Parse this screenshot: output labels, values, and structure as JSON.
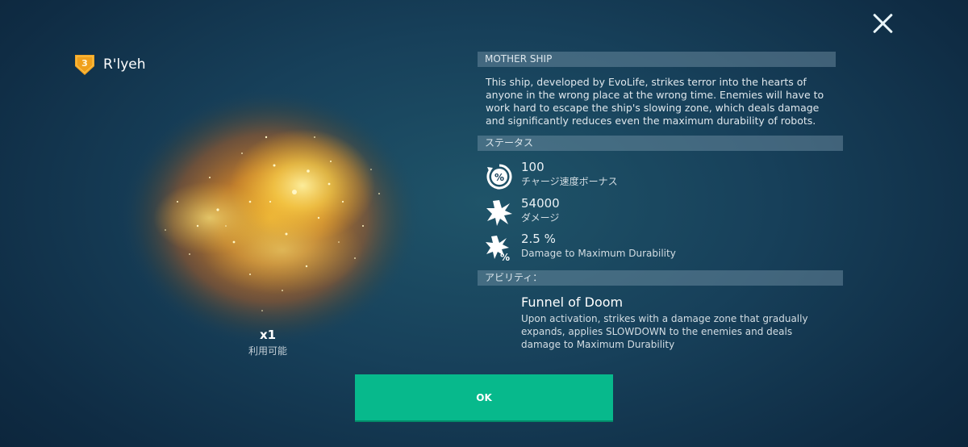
{
  "ship": {
    "level": "3",
    "name": "R'lyeh",
    "count": "x1",
    "availability": "利用可能"
  },
  "details": {
    "type_header": "MOTHER SHIP",
    "description": "This ship, developed by EvoLife, strikes terror into the hearts of anyone in the wrong place at the wrong time. Enemies will have to work hard to escape the ship's slowing zone, which deals damage and significantly reduces even the maximum durability of robots.",
    "status_header": "ステータス",
    "stats": [
      {
        "icon": "charge-speed-percent-icon",
        "value": "100",
        "label": "チャージ速度ボーナス"
      },
      {
        "icon": "damage-burst-icon",
        "value": "54000",
        "label": "ダメージ"
      },
      {
        "icon": "durability-damage-percent-icon",
        "value": "2.5 %",
        "label": "Damage to Maximum Durability"
      }
    ],
    "abilities_header": "アビリティ：",
    "ability": {
      "name": "Funnel of Doom",
      "description": "Upon activation, strikes with a damage zone that gradually expands, applies SLOWDOWN to the enemies and deals damage to Maximum Durability"
    }
  },
  "buttons": {
    "ok_label": "OK",
    "close_icon": "close-icon"
  },
  "colors": {
    "accent_button": "#07b98c",
    "badge": "#f5a623",
    "section_header_bg": "#5d7d8f",
    "background": "#17405a"
  }
}
